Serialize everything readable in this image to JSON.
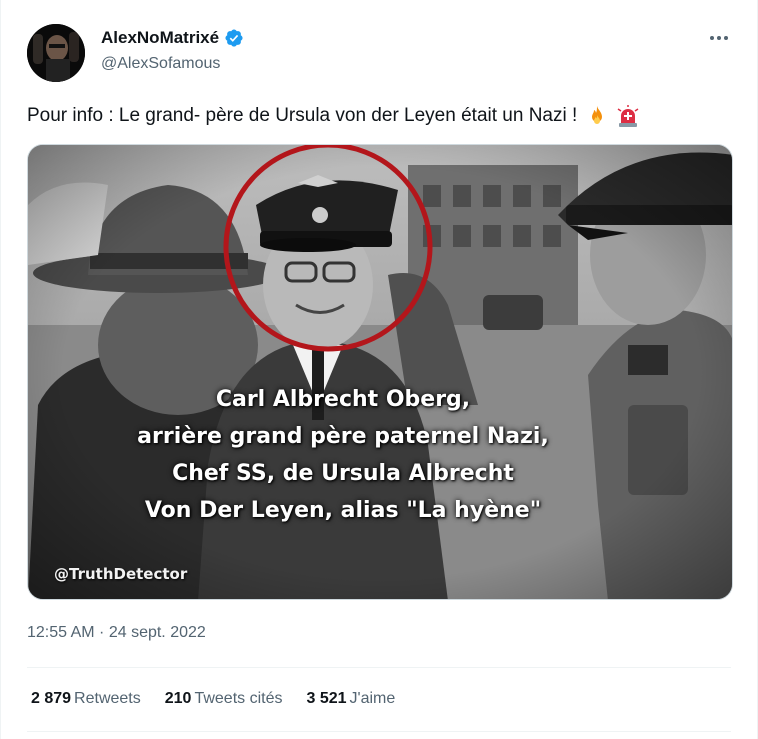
{
  "author": {
    "display_name": "AlexNoMatrixé",
    "handle": "@AlexSofamous",
    "verified": true
  },
  "tweet": {
    "text": "Pour info :   Le grand- père de Ursula von der Leyen était un Nazi  !",
    "emojis": [
      "fire-emoji",
      "rotating-light-emoji"
    ],
    "timestamp": "12:55 AM · 24 sept. 2022"
  },
  "media": {
    "caption_lines": [
      "Carl Albrecht Oberg,",
      "arrière grand père paternel Nazi,",
      "Chef SS, de Ursula Albrecht",
      "Von Der Leyen, alias \"La hyène\""
    ],
    "watermark": "@TruthDetector"
  },
  "stats": [
    {
      "count": "2 879",
      "label": "Retweets"
    },
    {
      "count": "210",
      "label": "Tweets cités"
    },
    {
      "count": "3 521",
      "label": "J'aime"
    }
  ],
  "colors": {
    "verified_badge": "#1d9bf0",
    "circle_highlight": "#b3161b",
    "secondary_text": "#536471"
  }
}
